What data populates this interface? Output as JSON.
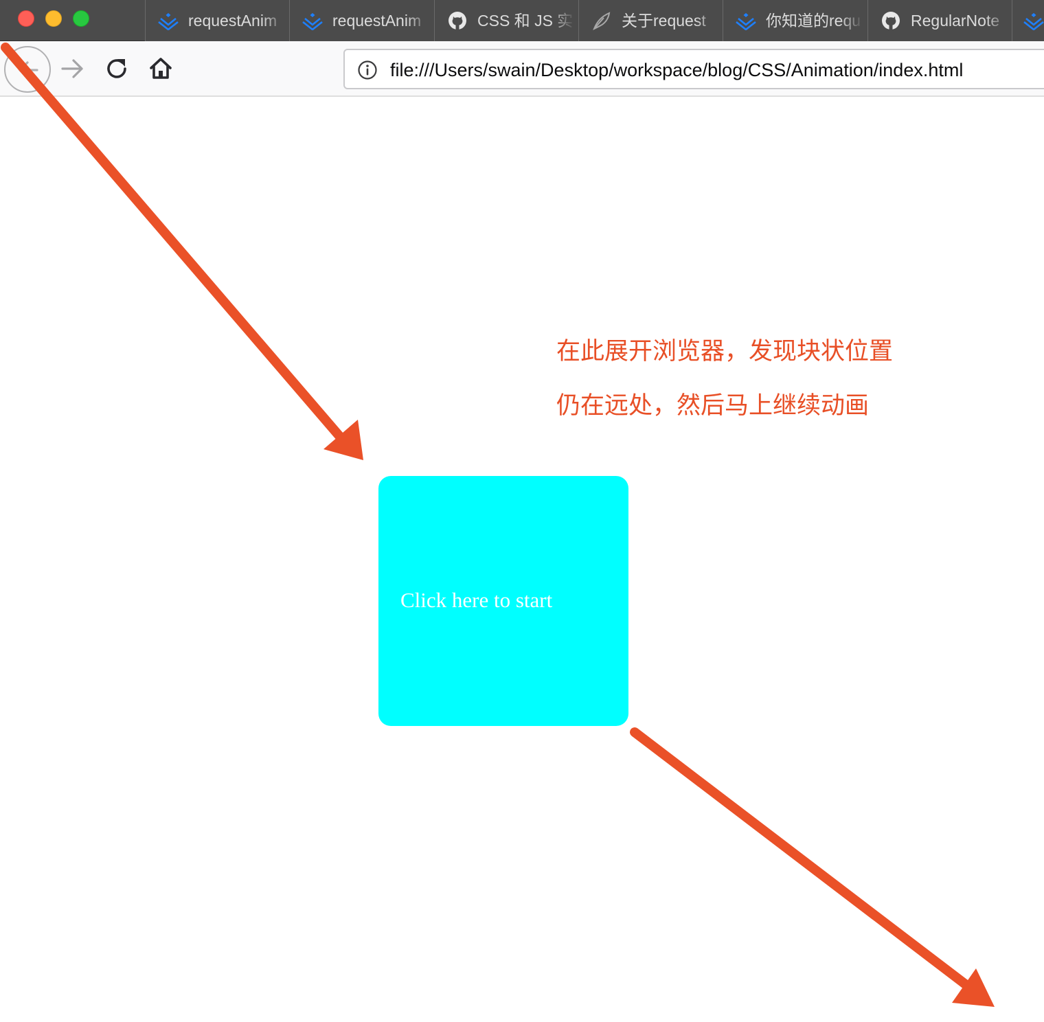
{
  "browser": {
    "tabs": [
      {
        "label": "requestAnim",
        "icon": "juejin-icon"
      },
      {
        "label": "requestAnim",
        "icon": "juejin-icon"
      },
      {
        "label": "CSS 和 JS 实",
        "icon": "github-icon"
      },
      {
        "label": "关于request",
        "icon": "feather-icon"
      },
      {
        "label": "你知道的requ",
        "icon": "juejin-icon"
      },
      {
        "label": "RegularNote",
        "icon": "github-icon"
      },
      {
        "label": "",
        "icon": "juejin-icon"
      }
    ],
    "url": "file:///Users/swain/Desktop/workspace/blog/CSS/Animation/index.html"
  },
  "page": {
    "box_label": "Click here to start",
    "box_color": "#00ffff",
    "annotation": {
      "line1": "在此展开浏览器，发现块状位置",
      "line2": "仍在远处，然后马上继续动画",
      "color": "#e84f26"
    }
  }
}
